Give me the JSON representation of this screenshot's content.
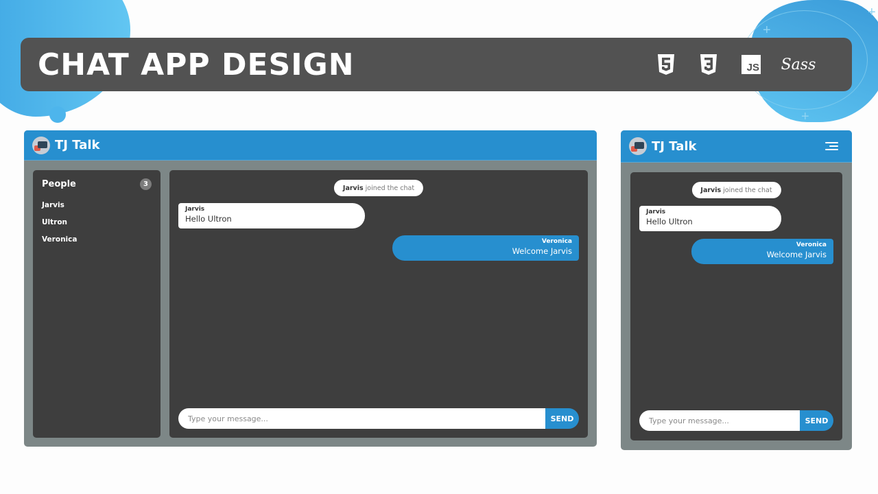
{
  "banner": {
    "title": "CHAT APP DESIGN",
    "tech_icons": [
      "html5-icon",
      "css3-icon",
      "javascript-icon",
      "sass-icon"
    ],
    "js_label": "JS",
    "sass_label": "Sass"
  },
  "colors": {
    "accent": "#278fcf",
    "frame": "#7d8787",
    "panel": "#3e3e3e",
    "banner": "#525252"
  },
  "desktop": {
    "app_title": "TJ Talk",
    "sidebar": {
      "title": "People",
      "count": "3",
      "people": [
        "Jarvis",
        "Ultron",
        "Veronica"
      ]
    },
    "chat": {
      "notice": {
        "name": "Jarvis",
        "text": "joined the chat"
      },
      "messages": [
        {
          "sender": "Jarvis",
          "text": "Hello Ultron",
          "direction": "incoming"
        },
        {
          "sender": "Veronica",
          "text": "Welcome Jarvis",
          "direction": "outgoing"
        }
      ],
      "input_placeholder": "Type your message...",
      "send_label": "SEND"
    }
  },
  "mobile": {
    "app_title": "TJ Talk",
    "chat": {
      "notice": {
        "name": "Jarvis",
        "text": "joined the chat"
      },
      "messages": [
        {
          "sender": "Jarvis",
          "text": "Hello Ultron",
          "direction": "incoming"
        },
        {
          "sender": "Veronica",
          "text": "Welcome Jarvis",
          "direction": "outgoing"
        }
      ],
      "input_placeholder": "Type your message...",
      "send_label": "SEND"
    }
  }
}
